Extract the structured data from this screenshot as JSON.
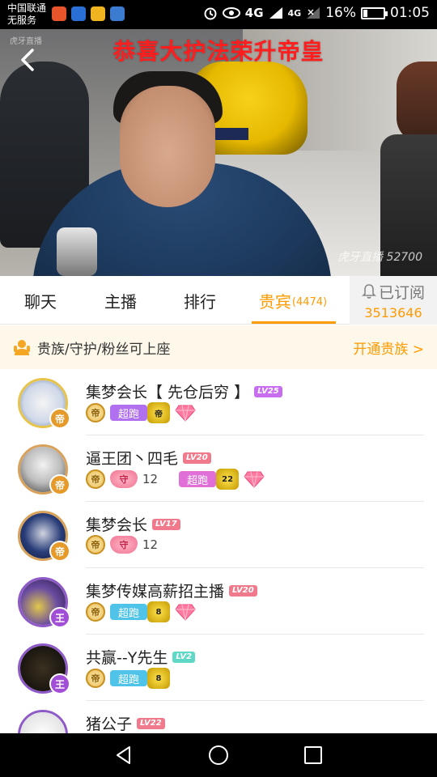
{
  "status_bar": {
    "carrier_line1": "中国联通",
    "carrier_line2": "无服务",
    "network": "4G",
    "network2": "4G",
    "battery": "16%",
    "time": "01:05",
    "app_colors": [
      "#e8552b",
      "#2a6fd6",
      "#f0b420",
      "#3b7bd0"
    ]
  },
  "video": {
    "banner": "恭喜大护法荣升帝皇",
    "top_watermark": "虎牙直播",
    "watermark": "虎牙直播 52700"
  },
  "tabs": [
    {
      "label": "聊天"
    },
    {
      "label": "主播"
    },
    {
      "label": "排行"
    },
    {
      "label": "贵宾",
      "count": "(4474)"
    }
  ],
  "subscribe": {
    "label": "已订阅",
    "count": "3513646"
  },
  "notice": {
    "text": "贵族/守护/粉丝可上座",
    "link": "开通贵族 >"
  },
  "members": [
    {
      "name": "集梦会长【 先仓后穷 】",
      "level": "LV25",
      "level_color": "#c86cf0",
      "rank": "帝",
      "rank_color": "#e69a2a",
      "border": "#e8c34a",
      "guard": null,
      "chaopao": "超跑",
      "chaopao_color": "#b070f0",
      "car": "帝",
      "diamond": true
    },
    {
      "name": "逼王团丶四毛",
      "level": "LV20",
      "level_color": "#f07a8c",
      "rank": "帝",
      "rank_color": "#e69a2a",
      "border": "#d9a25a",
      "guard": "守",
      "guard_count": "12",
      "chaopao": "超跑",
      "chaopao_color": "#e070d8",
      "car": "22",
      "diamond": true
    },
    {
      "name": "集梦会长",
      "level": "LV17",
      "level_color": "#f07a8c",
      "rank": "帝",
      "rank_color": "#e69a2a",
      "border": "#d9a25a",
      "guard": "守",
      "guard_count": "12",
      "chaopao": null,
      "car": null,
      "diamond": false
    },
    {
      "name": "集梦传媒高薪招主播",
      "level": "LV20",
      "level_color": "#f07a8c",
      "rank": "王",
      "rank_color": "#a24fd8",
      "border": "#8e5ac8",
      "guard": null,
      "chaopao": "超跑",
      "chaopao_color": "#4fc4e8",
      "car": "8",
      "diamond": true
    },
    {
      "name": "共赢--Y先生",
      "level": "LV2",
      "level_color": "#5fd8c8",
      "rank": "王",
      "rank_color": "#a24fd8",
      "border": "#8e5ac8",
      "guard": null,
      "chaopao": "超跑",
      "chaopao_color": "#4fc4e8",
      "car": "8",
      "diamond": false
    },
    {
      "name": "猪公子",
      "level": "LV22",
      "level_color": "#f07a8c",
      "rank": "",
      "rank_color": "#a24fd8",
      "border": "#aaaaaa",
      "guard": null,
      "chaopao": null,
      "car": null,
      "diamond": false
    }
  ]
}
